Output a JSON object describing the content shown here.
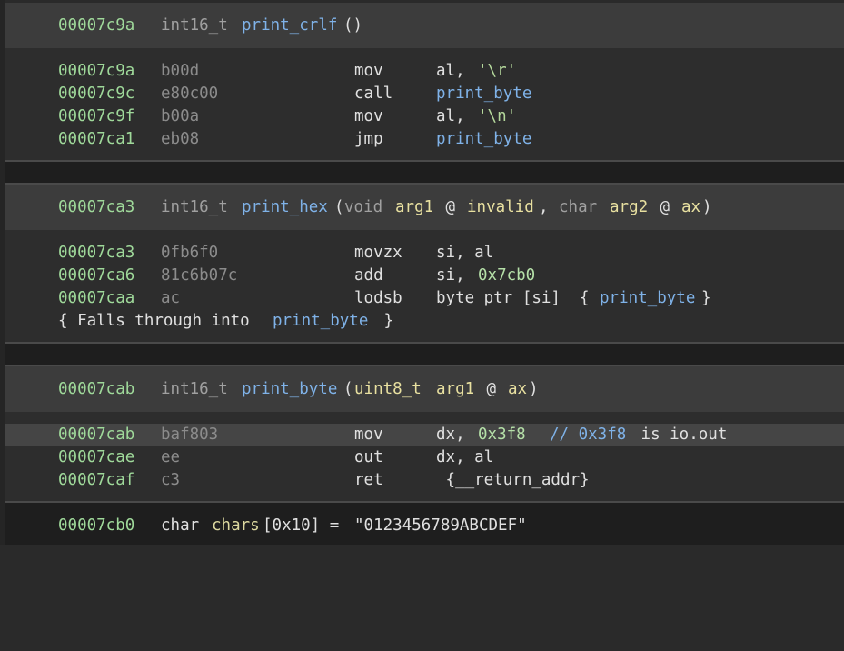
{
  "functions": [
    {
      "header": {
        "addr": "00007c9a",
        "ret_type": "int16_t",
        "name": "print_crlf",
        "sig_tail": "()"
      },
      "rows": [
        {
          "addr": "00007c9a",
          "bytes": "b00d",
          "mnem": "mov",
          "op1": "al, ",
          "op2": "'\\r'"
        },
        {
          "addr": "00007c9c",
          "bytes": "e80c00",
          "mnem": "call",
          "op1": "",
          "op2": "print_byte"
        },
        {
          "addr": "00007c9f",
          "bytes": "b00a",
          "mnem": "mov",
          "op1": "al, ",
          "op2": "'\\n'"
        },
        {
          "addr": "00007ca1",
          "bytes": "eb08",
          "mnem": "jmp",
          "op1": "",
          "op2": "print_byte"
        }
      ]
    },
    {
      "header": {
        "addr": "00007ca3",
        "ret_type": "int16_t",
        "name": "print_hex",
        "p_open": "(",
        "a1_type": "void",
        "a1_name": "arg1",
        "a1_at": " @ ",
        "a1_reg": "invalid",
        "comma": ", ",
        "a2_type": "char",
        "a2_name": "arg2",
        "a2_at": " @ ",
        "a2_reg": "ax",
        "p_close": ")"
      },
      "rows": [
        {
          "addr": "00007ca3",
          "bytes": "0fb6f0",
          "mnem": "movzx",
          "op1": "si, al",
          "op2": ""
        },
        {
          "addr": "00007ca6",
          "bytes": "81c6b07c",
          "mnem": "add",
          "op1": "si, ",
          "op2": "0x7cb0"
        },
        {
          "addr": "00007caa",
          "bytes": "ac",
          "mnem": "lodsb",
          "op1": "byte ptr [si]  {",
          "op2": "print_byte",
          "op3": "}"
        }
      ],
      "fallthrough": {
        "pre": "{ Falls through into ",
        "target": "print_byte",
        "post": " }"
      }
    },
    {
      "header": {
        "addr": "00007cab",
        "ret_type": "int16_t",
        "name": "print_byte",
        "p_open": "(",
        "a1_type": "uint8_t",
        "a1_name": "arg1",
        "a1_at": " @ ",
        "a1_reg": "ax",
        "p_close": ")"
      },
      "rows": [
        {
          "addr": "00007cab",
          "bytes": "baf803",
          "mnem": "mov",
          "op1": "dx, ",
          "op2": "0x3f8",
          "comment": "// 0x3f8",
          "comment_tail": " is io.out"
        },
        {
          "addr": "00007cae",
          "bytes": "ee",
          "mnem": "out",
          "op1": "dx, al",
          "op2": ""
        },
        {
          "addr": "00007caf",
          "bytes": "c3",
          "mnem": "ret",
          "op1": " {__return_addr}",
          "op2": ""
        }
      ]
    }
  ],
  "data_line": {
    "addr": "00007cb0",
    "type": "char",
    "name": "chars",
    "dims": "[0x10] = ",
    "value": "\"0123456789ABCDEF\""
  }
}
